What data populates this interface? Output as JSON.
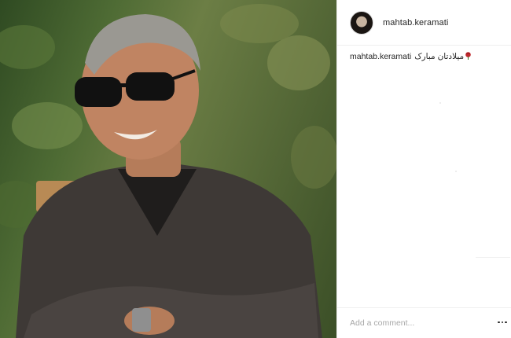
{
  "post": {
    "photo": {
      "icon": "photo-of-smiling-man-with-sunglasses"
    },
    "header": {
      "username": "mahtab.keramati",
      "avatar_icon": "avatar-icon"
    },
    "caption": {
      "username": "mahtab.keramati",
      "text": "میلادتان مبارک",
      "emoji_icon": "rose-icon"
    },
    "comment": {
      "placeholder": "Add a comment...",
      "value": ""
    },
    "options_icon": "more-options-icon"
  },
  "colors": {
    "text": "#262626",
    "placeholder": "#a8a8a8",
    "border": "#efefef"
  }
}
